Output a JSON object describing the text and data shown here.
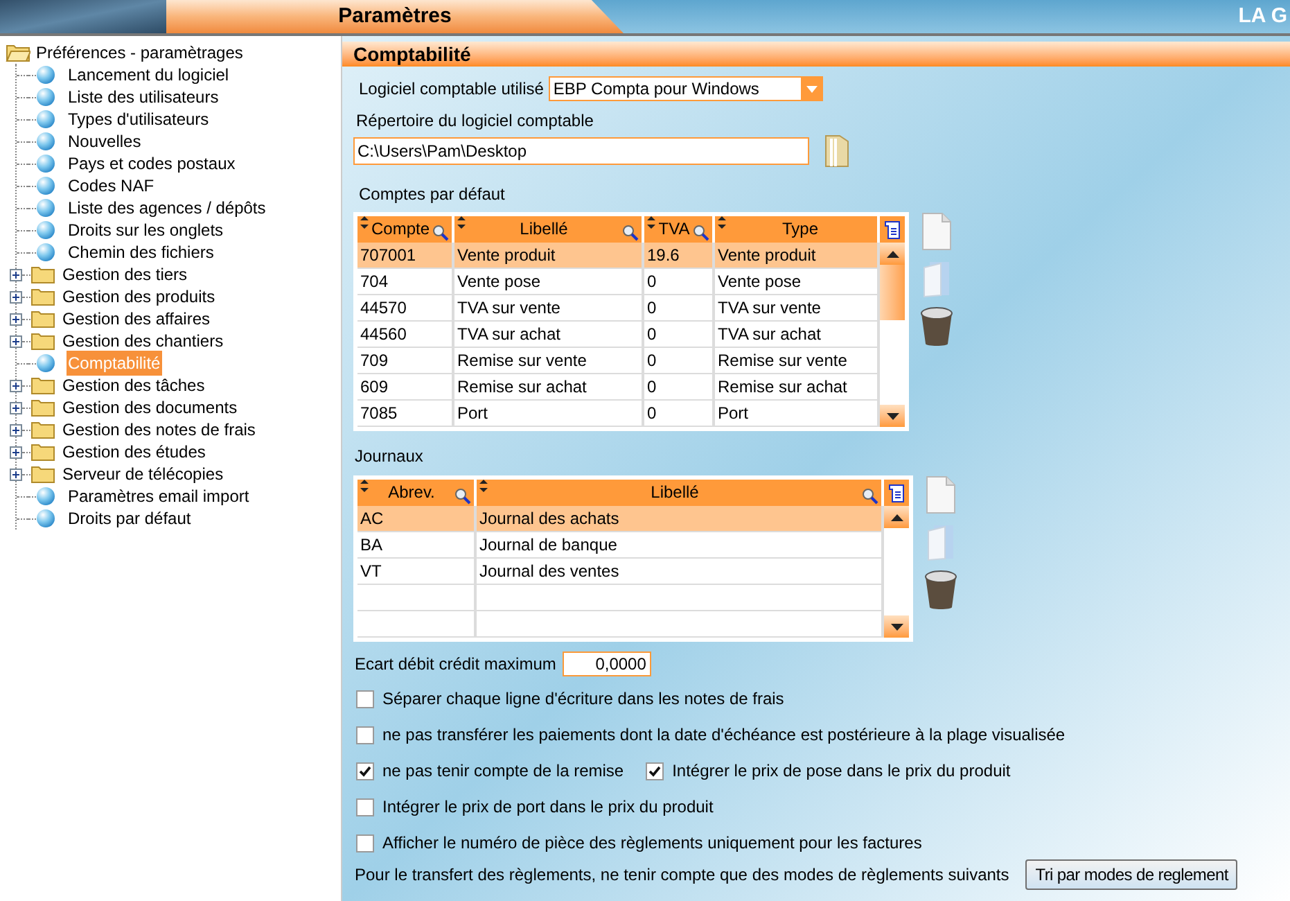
{
  "header": {
    "title": "Paramètres",
    "brand": "LA G"
  },
  "tree": {
    "label": "Préférences - paramètrages",
    "expanded": true,
    "children": [
      {
        "label": "Lancement du logiciel",
        "kind": "leaf",
        "selected": false
      },
      {
        "label": "Liste des utilisateurs",
        "kind": "leaf",
        "selected": false
      },
      {
        "label": "Types d'utilisateurs",
        "kind": "leaf",
        "selected": false
      },
      {
        "label": "Nouvelles",
        "kind": "leaf",
        "selected": false
      },
      {
        "label": "Pays et codes postaux",
        "kind": "leaf",
        "selected": false
      },
      {
        "label": "Codes NAF",
        "kind": "leaf",
        "selected": false
      },
      {
        "label": "Liste des agences / dépôts",
        "kind": "leaf",
        "selected": false
      },
      {
        "label": "Droits sur les onglets",
        "kind": "leaf",
        "selected": false
      },
      {
        "label": "Chemin des fichiers",
        "kind": "leaf",
        "selected": false
      },
      {
        "label": "Gestion des tiers",
        "kind": "folder",
        "expanded": false,
        "selected": false
      },
      {
        "label": "Gestion des produits",
        "kind": "folder",
        "expanded": false,
        "selected": false
      },
      {
        "label": "Gestion des affaires",
        "kind": "folder",
        "expanded": false,
        "selected": false
      },
      {
        "label": "Gestion des chantiers",
        "kind": "folder",
        "expanded": false,
        "selected": false
      },
      {
        "label": "Comptabilité",
        "kind": "leaf",
        "selected": true
      },
      {
        "label": "Gestion des tâches",
        "kind": "folder",
        "expanded": false,
        "selected": false
      },
      {
        "label": "Gestion des documents",
        "kind": "folder",
        "expanded": false,
        "selected": false
      },
      {
        "label": "Gestion des notes de frais",
        "kind": "folder",
        "expanded": false,
        "selected": false
      },
      {
        "label": "Gestion des études",
        "kind": "folder",
        "expanded": false,
        "selected": false
      },
      {
        "label": "Serveur de télécopies",
        "kind": "folder",
        "expanded": false,
        "selected": false
      },
      {
        "label": "Paramètres email import",
        "kind": "leaf",
        "selected": false
      },
      {
        "label": "Droits par défaut",
        "kind": "leaf",
        "selected": false
      }
    ]
  },
  "panel": {
    "title": "Comptabilité",
    "software": {
      "label": "Logiciel comptable utilisé",
      "value": "EBP Compta pour Windows"
    },
    "directory": {
      "label": "Répertoire du logiciel comptable",
      "value": "C:\\Users\\Pam\\Desktop"
    },
    "accounts": {
      "label": "Comptes par défaut",
      "columns": [
        "Compte",
        "Libellé",
        "TVA",
        "Type"
      ],
      "rows": [
        {
          "cells": [
            "707001",
            "Vente produit",
            "19.6",
            "Vente produit"
          ],
          "selected": true
        },
        {
          "cells": [
            "704",
            "Vente pose",
            "0",
            "Vente pose"
          ],
          "selected": false
        },
        {
          "cells": [
            "44570",
            "TVA sur vente",
            "0",
            "TVA sur vente"
          ],
          "selected": false
        },
        {
          "cells": [
            "44560",
            "TVA sur achat",
            "0",
            "TVA sur achat"
          ],
          "selected": false
        },
        {
          "cells": [
            "709",
            "Remise sur vente",
            "0",
            "Remise sur vente"
          ],
          "selected": false
        },
        {
          "cells": [
            "609",
            "Remise sur achat",
            "0",
            "Remise sur achat"
          ],
          "selected": false
        },
        {
          "cells": [
            "7085",
            "Port",
            "0",
            "Port"
          ],
          "selected": false
        }
      ]
    },
    "journals": {
      "label": "Journaux",
      "columns": [
        "Abrev.",
        "Libellé"
      ],
      "rows": [
        {
          "cells": [
            "AC",
            "Journal des achats"
          ],
          "selected": true
        },
        {
          "cells": [
            "BA",
            "Journal de banque"
          ],
          "selected": false
        },
        {
          "cells": [
            "VT",
            "Journal des ventes"
          ],
          "selected": false
        }
      ]
    },
    "max_gap": {
      "label": "Ecart débit crédit maximum",
      "value": "0,0000"
    },
    "options": [
      [
        {
          "label": "Séparer chaque ligne d'écriture dans les notes de frais",
          "checked": false
        }
      ],
      [
        {
          "label": "ne pas transférer les paiements dont la date d'échéance est postérieure à la plage visualisée",
          "checked": false
        }
      ],
      [
        {
          "label": "ne pas tenir compte de la remise",
          "checked": true
        },
        {
          "label": "Intégrer le prix de pose dans le prix du produit",
          "checked": true
        }
      ],
      [
        {
          "label": "Intégrer le prix de port dans le prix du produit",
          "checked": false
        }
      ],
      [
        {
          "label": "Afficher le numéro de pièce des règlements uniquement pour les factures",
          "checked": false
        }
      ]
    ],
    "transfer": {
      "label": "Pour le transfert des règlements, ne tenir compte que des modes de règlements suivants",
      "button": "Tri par modes de reglement"
    }
  }
}
